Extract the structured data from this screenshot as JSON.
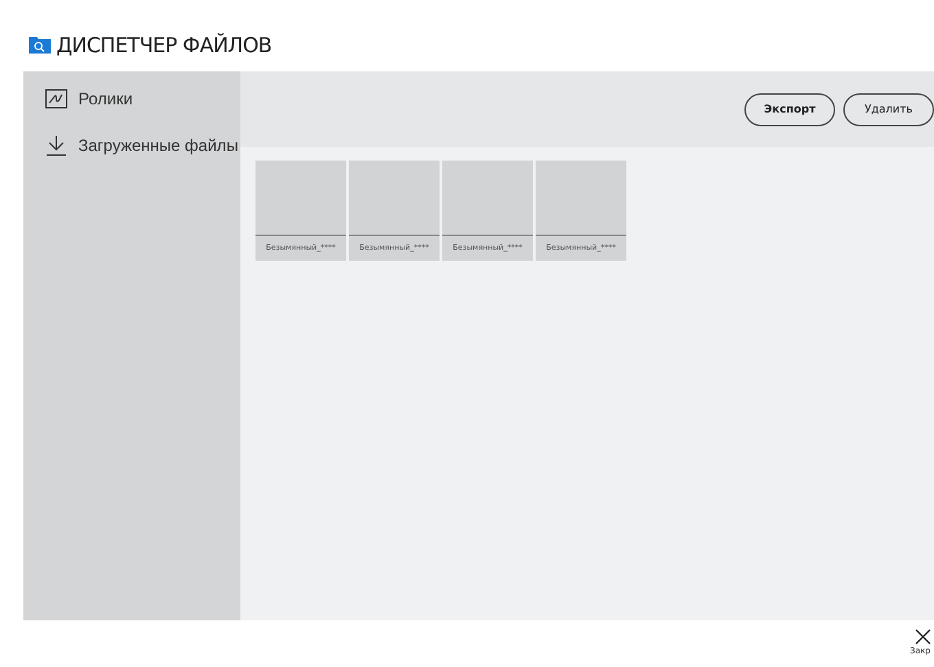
{
  "window": {
    "title": "ДИСПЕТЧЕР ФАЙЛОВ"
  },
  "sidebar": {
    "items": [
      {
        "label": "Ролики",
        "kind": "clips"
      },
      {
        "label": "Загруженные файлы",
        "kind": "downloads"
      }
    ]
  },
  "toolbar": {
    "buttons": [
      "Экспорт",
      "Удалить"
    ]
  },
  "files": [
    {
      "name": "Безымянный_****"
    },
    {
      "name": "Безымянный_****"
    },
    {
      "name": "Безымянный_****"
    },
    {
      "name": "Безымянный_****"
    }
  ],
  "footer": {
    "close_label": "Закр"
  }
}
